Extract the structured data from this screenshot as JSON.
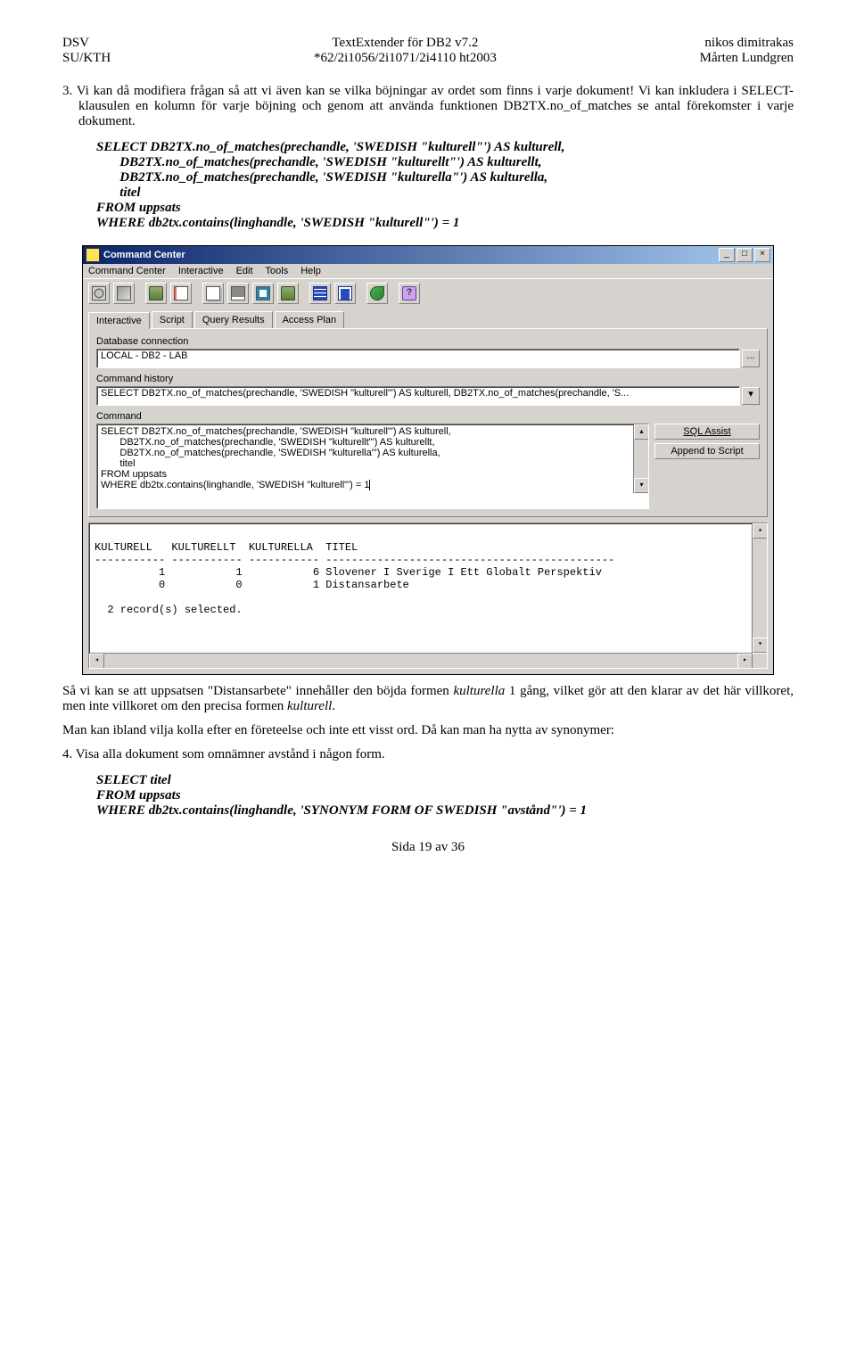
{
  "header": {
    "left": "DSV\nSU/KTH",
    "center": "TextExtender för DB2 v7.2\n*62/2i1056/2i1071/2i4110 ht2003",
    "right": "nikos dimitrakas\nMårten Lundgren"
  },
  "para1": "3.  Vi kan då modifiera frågan så att vi även kan se vilka böjningar av ordet som finns i varje dokument! Vi kan inkludera i SELECT-klausulen en kolumn för varje böjning och genom att använda funktionen DB2TX.no_of_matches se antal förekomster i varje dokument.",
  "sql1": "SELECT DB2TX.no_of_matches(prechandle, 'SWEDISH \"kulturell\"') AS kulturell,\n       DB2TX.no_of_matches(prechandle, 'SWEDISH \"kulturellt\"') AS kulturellt,\n       DB2TX.no_of_matches(prechandle, 'SWEDISH \"kulturella\"') AS kulturella,\n       titel\nFROM uppsats\nWHERE db2tx.contains(linghandle, 'SWEDISH \"kulturell\"') = 1",
  "cc": {
    "title": "Command Center",
    "menu": [
      "Command Center",
      "Interactive",
      "Edit",
      "Tools",
      "Help"
    ],
    "tabs": [
      "Interactive",
      "Script",
      "Query Results",
      "Access Plan"
    ],
    "lbl_dbconn": "Database connection",
    "dbconn_value": "LOCAL - DB2 - LAB",
    "lbl_hist": "Command history",
    "hist_value": "SELECT DB2TX.no_of_matches(prechandle, 'SWEDISH \"kulturell\"') AS kulturell, DB2TX.no_of_matches(prechandle, 'S...",
    "lbl_cmd": "Command",
    "cmd_text": "SELECT DB2TX.no_of_matches(prechandle, 'SWEDISH \"kulturell\"') AS kulturell,\n       DB2TX.no_of_matches(prechandle, 'SWEDISH \"kulturellt\"') AS kulturellt,\n       DB2TX.no_of_matches(prechandle, 'SWEDISH \"kulturella\"') AS kulturella,\n       titel\nFROM uppsats\nWHERE db2tx.contains(linghandle, 'SWEDISH \"kulturell\"') = 1",
    "btn_sqlassist": "SQL Assist",
    "btn_append": "Append to Script",
    "results": "\nKULTURELL   KULTURELLT  KULTURELLA  TITEL\n----------- ----------- ----------- ---------------------------------------------\n          1           1           6 Slovener I Sverige I Ett Globalt Perspektiv\n          0           0           1 Distansarbete\n\n  2 record(s) selected.\n"
  },
  "para2": "Så vi kan se att uppsatsen \"Distansarbete\" innehåller den böjda formen kulturella 1 gång, vilket gör att den klarar av det här villkoret, men inte villkoret om den precisa formen kulturell.",
  "para3": "Man kan ibland vilja kolla efter en företeelse och inte ett visst ord. Då kan man ha nytta av synonymer:",
  "para4": "4.  Visa alla dokument som omnämner avstånd i någon form.",
  "sql2": "SELECT titel\nFROM uppsats\nWHERE db2tx.contains(linghandle, 'SYNONYM FORM OF SWEDISH \"avstånd\"') = 1",
  "footer": "Sida 19 av 36"
}
